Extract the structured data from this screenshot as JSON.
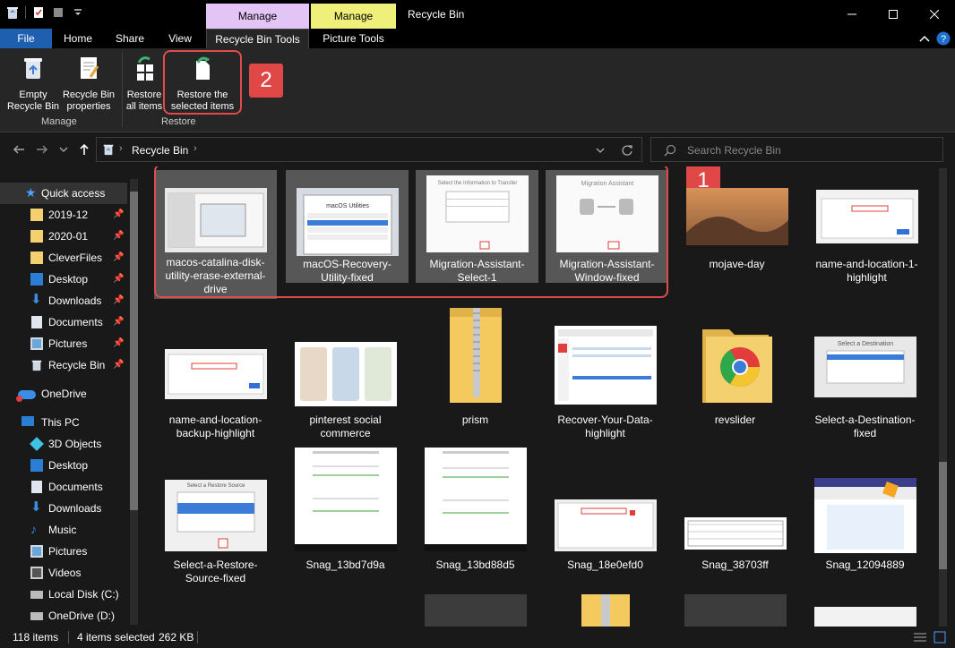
{
  "window": {
    "title": "Recycle Bin",
    "context_tab_1": "Manage",
    "context_tab_2": "Manage"
  },
  "tabs": [
    "File",
    "Home",
    "Share",
    "View",
    "Recycle Bin Tools",
    "Picture Tools"
  ],
  "ribbon": {
    "empty_line1": "Empty",
    "empty_line2": "Recycle Bin",
    "props_line1": "Recycle Bin",
    "props_line2": "properties",
    "restore_all_line1": "Restore",
    "restore_all_line2": "all items",
    "restore_sel_line1": "Restore the",
    "restore_sel_line2": "selected items",
    "group_manage": "Manage",
    "group_restore": "Restore"
  },
  "badges": {
    "one": "1",
    "two": "2"
  },
  "address": {
    "crumb": "Recycle Bin",
    "search_placeholder": "Search Recycle Bin"
  },
  "sidebar": {
    "quick_access": "Quick access",
    "items": [
      "2019-12",
      "2020-01",
      "CleverFiles",
      "Desktop",
      "Downloads",
      "Documents",
      "Pictures",
      "Recycle Bin"
    ],
    "onedrive": "OneDrive",
    "this_pc": "This PC",
    "pc_items": [
      "3D Objects",
      "Desktop",
      "Documents",
      "Downloads",
      "Music",
      "Pictures",
      "Videos",
      "Local Disk (C:)",
      "OneDrive (D:)"
    ]
  },
  "files": [
    "macos-catalina-disk-utility-erase-external-drive",
    "macOS-Recovery-Utility-fixed",
    "Migration-Assistant-Select-1",
    "Migration-Assistant-Window-fixed",
    "mojave-day",
    "name-and-location-1-highlight",
    "name-and-location-backup-highlight",
    "pinterest social commerce",
    "prism",
    "Recover-Your-Data-highlight",
    "revslider",
    "Select-a-Destination-fixed",
    "Select-a-Restore-Source-fixed",
    "Snag_13bd7d9a",
    "Snag_13bd88d5",
    "Snag_18e0efd0",
    "Snag_38703ff",
    "Snag_12094889"
  ],
  "thumb_captions": {
    "macos_utilities": "macOS Utilities",
    "migration_title": "Migration Assistant",
    "select_transfer": "Select the Information to Transfer",
    "select_destination": "Select a Destination",
    "select_restore_source": "Select a Restore Source"
  },
  "status": {
    "count": "118 items",
    "selected": "4 items selected",
    "size": "262 KB"
  },
  "colors": {
    "accent": "#1f5fb0",
    "highlight": "#e04848",
    "manage1": "#e3c5f5",
    "manage2": "#eef07a"
  }
}
